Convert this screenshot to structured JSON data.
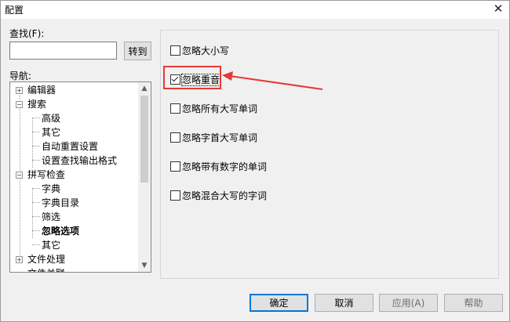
{
  "window": {
    "title": "配置",
    "close_glyph": "✕"
  },
  "find": {
    "label": "查找(F):",
    "value": "",
    "goto_label": "转到"
  },
  "nav": {
    "label": "导航:",
    "items": [
      {
        "label": "编辑器",
        "level": 0,
        "toggle": "+"
      },
      {
        "label": "搜索",
        "level": 0,
        "toggle": "−"
      },
      {
        "label": "高级",
        "level": 1
      },
      {
        "label": "其它",
        "level": 1
      },
      {
        "label": "自动重置设置",
        "level": 1
      },
      {
        "label": "设置查找输出格式",
        "level": 1
      },
      {
        "label": "拼写检查",
        "level": 0,
        "toggle": "−"
      },
      {
        "label": "字典",
        "level": 1
      },
      {
        "label": "字典目录",
        "level": 1
      },
      {
        "label": "筛选",
        "level": 1
      },
      {
        "label": "忽略选项",
        "level": 1,
        "selected": true
      },
      {
        "label": "其它",
        "level": 1
      },
      {
        "label": "文件处理",
        "level": 0,
        "toggle": "+"
      },
      {
        "label": "文件关联",
        "level": 0
      }
    ]
  },
  "options": [
    {
      "label": "忽略大小写",
      "checked": false
    },
    {
      "label": "忽略重音",
      "checked": true,
      "highlighted": true
    },
    {
      "label": "忽略所有大写单词",
      "checked": false
    },
    {
      "label": "忽略字首大写单词",
      "checked": false
    },
    {
      "label": "忽略带有数字的单词",
      "checked": false
    },
    {
      "label": "忽略混合大写的字词",
      "checked": false
    }
  ],
  "buttons": {
    "ok": "确定",
    "cancel": "取消",
    "apply": "应用(A)",
    "help": "帮助"
  },
  "annotation_color": "#e53935",
  "accent_color": "#0078d7"
}
